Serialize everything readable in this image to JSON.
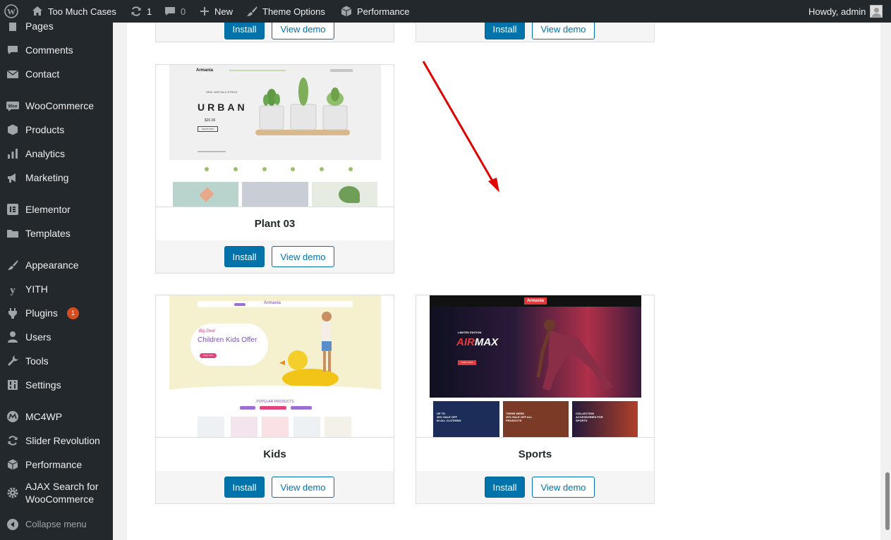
{
  "adminbar": {
    "site_name": "Too Much Cases",
    "updates_count": "1",
    "comments_count": "0",
    "new_label": "New",
    "theme_options_label": "Theme Options",
    "performance_label": "Performance",
    "greeting": "Howdy, admin"
  },
  "sidebar": {
    "items": [
      {
        "label": "Pages",
        "icon": "pages-icon"
      },
      {
        "label": "Comments",
        "icon": "comments-icon"
      },
      {
        "label": "Contact",
        "icon": "mail-icon"
      },
      {
        "label": "WooCommerce",
        "icon": "woocommerce-icon"
      },
      {
        "label": "Products",
        "icon": "products-icon"
      },
      {
        "label": "Analytics",
        "icon": "analytics-icon"
      },
      {
        "label": "Marketing",
        "icon": "marketing-icon"
      },
      {
        "label": "Elementor",
        "icon": "elementor-icon"
      },
      {
        "label": "Templates",
        "icon": "folder-icon"
      },
      {
        "label": "Appearance",
        "icon": "brush-icon"
      },
      {
        "label": "YITH",
        "icon": "yith-icon"
      },
      {
        "label": "Plugins",
        "icon": "plugin-icon",
        "badge": "1"
      },
      {
        "label": "Users",
        "icon": "users-icon"
      },
      {
        "label": "Tools",
        "icon": "wrench-icon"
      },
      {
        "label": "Settings",
        "icon": "settings-icon"
      },
      {
        "label": "MC4WP",
        "icon": "mc4wp-icon"
      },
      {
        "label": "Slider Revolution",
        "icon": "slider-icon"
      },
      {
        "label": "Performance",
        "icon": "performance-icon"
      },
      {
        "label": "AJAX Search for",
        "label2": "WooCommerce",
        "icon": "gear-icon"
      }
    ],
    "collapse_label": "Collapse menu"
  },
  "demos": {
    "install_label": "Install",
    "view_demo_label": "View demo",
    "cards": [
      {
        "title": "Plant 03"
      },
      {
        "title": "Kids"
      },
      {
        "title": "Sports"
      }
    ],
    "plant_shot": {
      "brand": "Armania",
      "headline": "URBAN",
      "price": "$20.06",
      "cta": "SHOP NOW",
      "subtitle": "NEW VARTIALS STRUG"
    },
    "kids_shot": {
      "brand": "Armania",
      "eyebrow": "Big Deal",
      "headline": "Children Kids Offer",
      "cta": "Shop Now",
      "section": "POPULAR PRODUCTS"
    },
    "sports_shot": {
      "brand": "Armania",
      "eyebrow": "LIMITED EDITION",
      "headline_part1": "AIR",
      "headline_part2": "MAX",
      "cta": "SHOP NOW",
      "promo1_line1": "UP TO",
      "promo1_line2": "40% SALE OFF",
      "promo1_line3": "IN ALL CLOTHING",
      "promo2_line1": "THESE WEEK",
      "promo2_line2": "20% SALE OFF ALL",
      "promo2_line3": "PRODUCTS",
      "promo3_line1": "COLLECTION",
      "promo3_line2": "ACCESSORIES FOR",
      "promo3_line3": "SPORTS"
    }
  },
  "colors": {
    "adminbar_bg": "#23282d",
    "primary": "#0073aa",
    "badge": "#d54e21",
    "arrow": "#e00000"
  }
}
